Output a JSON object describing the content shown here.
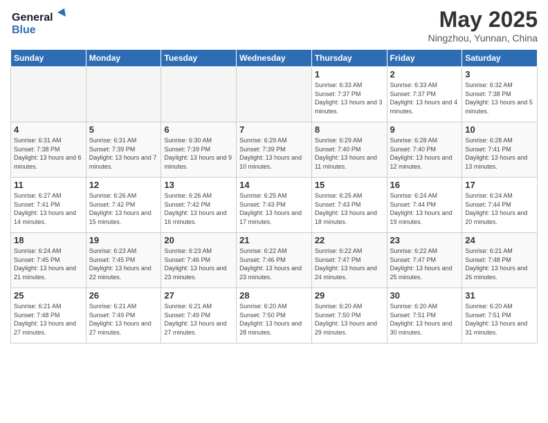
{
  "logo": {
    "line1": "General",
    "line2": "Blue"
  },
  "title": "May 2025",
  "location": "Ningzhou, Yunnan, China",
  "weekdays": [
    "Sunday",
    "Monday",
    "Tuesday",
    "Wednesday",
    "Thursday",
    "Friday",
    "Saturday"
  ],
  "weeks": [
    [
      {
        "day": "",
        "empty": true
      },
      {
        "day": "",
        "empty": true
      },
      {
        "day": "",
        "empty": true
      },
      {
        "day": "",
        "empty": true
      },
      {
        "day": "1",
        "sunrise": "6:33 AM",
        "sunset": "7:37 PM",
        "daylight": "13 hours and 3 minutes."
      },
      {
        "day": "2",
        "sunrise": "6:33 AM",
        "sunset": "7:37 PM",
        "daylight": "13 hours and 4 minutes."
      },
      {
        "day": "3",
        "sunrise": "6:32 AM",
        "sunset": "7:38 PM",
        "daylight": "13 hours and 5 minutes."
      }
    ],
    [
      {
        "day": "4",
        "sunrise": "6:31 AM",
        "sunset": "7:38 PM",
        "daylight": "13 hours and 6 minutes."
      },
      {
        "day": "5",
        "sunrise": "6:31 AM",
        "sunset": "7:39 PM",
        "daylight": "13 hours and 7 minutes."
      },
      {
        "day": "6",
        "sunrise": "6:30 AM",
        "sunset": "7:39 PM",
        "daylight": "13 hours and 9 minutes."
      },
      {
        "day": "7",
        "sunrise": "6:29 AM",
        "sunset": "7:39 PM",
        "daylight": "13 hours and 10 minutes."
      },
      {
        "day": "8",
        "sunrise": "6:29 AM",
        "sunset": "7:40 PM",
        "daylight": "13 hours and 11 minutes."
      },
      {
        "day": "9",
        "sunrise": "6:28 AM",
        "sunset": "7:40 PM",
        "daylight": "13 hours and 12 minutes."
      },
      {
        "day": "10",
        "sunrise": "6:28 AM",
        "sunset": "7:41 PM",
        "daylight": "13 hours and 13 minutes."
      }
    ],
    [
      {
        "day": "11",
        "sunrise": "6:27 AM",
        "sunset": "7:41 PM",
        "daylight": "13 hours and 14 minutes."
      },
      {
        "day": "12",
        "sunrise": "6:26 AM",
        "sunset": "7:42 PM",
        "daylight": "13 hours and 15 minutes."
      },
      {
        "day": "13",
        "sunrise": "6:26 AM",
        "sunset": "7:42 PM",
        "daylight": "13 hours and 16 minutes."
      },
      {
        "day": "14",
        "sunrise": "6:25 AM",
        "sunset": "7:43 PM",
        "daylight": "13 hours and 17 minutes."
      },
      {
        "day": "15",
        "sunrise": "6:25 AM",
        "sunset": "7:43 PM",
        "daylight": "13 hours and 18 minutes."
      },
      {
        "day": "16",
        "sunrise": "6:24 AM",
        "sunset": "7:44 PM",
        "daylight": "13 hours and 19 minutes."
      },
      {
        "day": "17",
        "sunrise": "6:24 AM",
        "sunset": "7:44 PM",
        "daylight": "13 hours and 20 minutes."
      }
    ],
    [
      {
        "day": "18",
        "sunrise": "6:24 AM",
        "sunset": "7:45 PM",
        "daylight": "13 hours and 21 minutes."
      },
      {
        "day": "19",
        "sunrise": "6:23 AM",
        "sunset": "7:45 PM",
        "daylight": "13 hours and 22 minutes."
      },
      {
        "day": "20",
        "sunrise": "6:23 AM",
        "sunset": "7:46 PM",
        "daylight": "13 hours and 23 minutes."
      },
      {
        "day": "21",
        "sunrise": "6:22 AM",
        "sunset": "7:46 PM",
        "daylight": "13 hours and 23 minutes."
      },
      {
        "day": "22",
        "sunrise": "6:22 AM",
        "sunset": "7:47 PM",
        "daylight": "13 hours and 24 minutes."
      },
      {
        "day": "23",
        "sunrise": "6:22 AM",
        "sunset": "7:47 PM",
        "daylight": "13 hours and 25 minutes."
      },
      {
        "day": "24",
        "sunrise": "6:21 AM",
        "sunset": "7:48 PM",
        "daylight": "13 hours and 26 minutes."
      }
    ],
    [
      {
        "day": "25",
        "sunrise": "6:21 AM",
        "sunset": "7:48 PM",
        "daylight": "13 hours and 27 minutes."
      },
      {
        "day": "26",
        "sunrise": "6:21 AM",
        "sunset": "7:49 PM",
        "daylight": "13 hours and 27 minutes."
      },
      {
        "day": "27",
        "sunrise": "6:21 AM",
        "sunset": "7:49 PM",
        "daylight": "13 hours and 27 minutes."
      },
      {
        "day": "28",
        "sunrise": "6:20 AM",
        "sunset": "7:50 PM",
        "daylight": "13 hours and 28 minutes."
      },
      {
        "day": "29",
        "sunrise": "6:20 AM",
        "sunset": "7:50 PM",
        "daylight": "13 hours and 29 minutes."
      },
      {
        "day": "30",
        "sunrise": "6:20 AM",
        "sunset": "7:51 PM",
        "daylight": "13 hours and 30 minutes."
      },
      {
        "day": "31",
        "sunrise": "6:20 AM",
        "sunset": "7:51 PM",
        "daylight": "13 hours and 31 minutes."
      }
    ]
  ]
}
